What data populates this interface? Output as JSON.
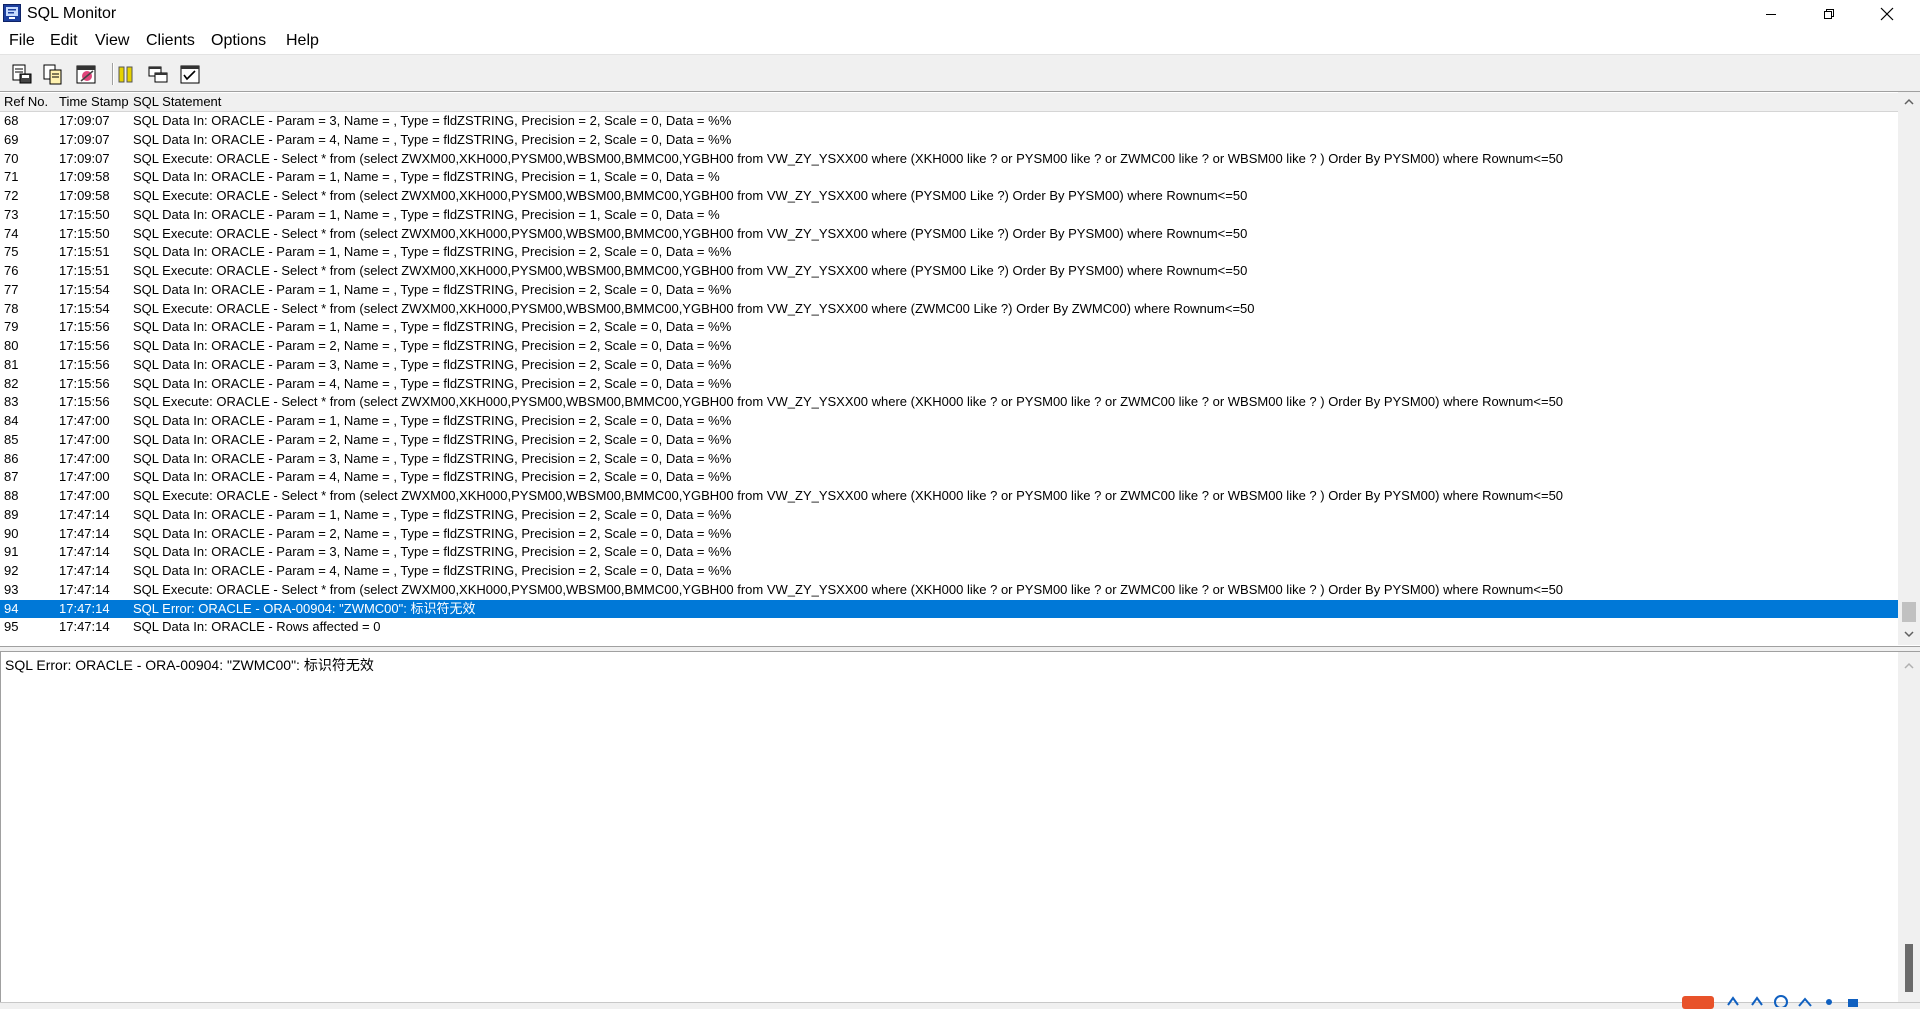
{
  "window": {
    "title": "SQL Monitor"
  },
  "menu": [
    "File",
    "Edit",
    "View",
    "Clients",
    "Options",
    "Help"
  ],
  "toolbar": {
    "icons": [
      "save-log-icon",
      "copy-icon",
      "clear-log-icon",
      "pause-icon",
      "window-tile-icon",
      "trace-options-icon"
    ]
  },
  "log": {
    "columns": {
      "ref": "Ref No.",
      "time": "Time Stamp",
      "sql": "SQL Statement"
    },
    "selected_ref": "94",
    "rows": [
      {
        "ref": "68",
        "time": "17:09:07",
        "sql": "SQL Data In: ORACLE - Param = 3, Name = , Type = fldZSTRING, Precision = 2, Scale = 0, Data = %%"
      },
      {
        "ref": "69",
        "time": "17:09:07",
        "sql": "SQL Data In: ORACLE - Param = 4, Name = , Type = fldZSTRING, Precision = 2, Scale = 0, Data = %%"
      },
      {
        "ref": "70",
        "time": "17:09:07",
        "sql": "SQL Execute: ORACLE - Select * from (select ZWXM00,XKH000,PYSM00,WBSM00,BMMC00,YGBH00 from VW_ZY_YSXX00 where (XKH000 like ? or PYSM00 like ? or ZWMC00 like ? or WBSM00 like ? ) Order By PYSM00) where Rownum<=50"
      },
      {
        "ref": "71",
        "time": "17:09:58",
        "sql": "SQL Data In: ORACLE - Param = 1, Name = , Type = fldZSTRING, Precision = 1, Scale = 0, Data = %"
      },
      {
        "ref": "72",
        "time": "17:09:58",
        "sql": "SQL Execute: ORACLE - Select * from (select ZWXM00,XKH000,PYSM00,WBSM00,BMMC00,YGBH00 from VW_ZY_YSXX00 where (PYSM00 Like ?) Order By PYSM00) where Rownum<=50"
      },
      {
        "ref": "73",
        "time": "17:15:50",
        "sql": "SQL Data In: ORACLE - Param = 1, Name = , Type = fldZSTRING, Precision = 1, Scale = 0, Data = %"
      },
      {
        "ref": "74",
        "time": "17:15:50",
        "sql": "SQL Execute: ORACLE - Select * from (select ZWXM00,XKH000,PYSM00,WBSM00,BMMC00,YGBH00 from VW_ZY_YSXX00 where (PYSM00 Like ?) Order By PYSM00) where Rownum<=50"
      },
      {
        "ref": "75",
        "time": "17:15:51",
        "sql": "SQL Data In: ORACLE - Param = 1, Name = , Type = fldZSTRING, Precision = 2, Scale = 0, Data = %%"
      },
      {
        "ref": "76",
        "time": "17:15:51",
        "sql": "SQL Execute: ORACLE - Select * from (select ZWXM00,XKH000,PYSM00,WBSM00,BMMC00,YGBH00 from VW_ZY_YSXX00 where (PYSM00 Like ?) Order By PYSM00) where Rownum<=50"
      },
      {
        "ref": "77",
        "time": "17:15:54",
        "sql": "SQL Data In: ORACLE - Param = 1, Name = , Type = fldZSTRING, Precision = 2, Scale = 0, Data = %%"
      },
      {
        "ref": "78",
        "time": "17:15:54",
        "sql": "SQL Execute: ORACLE - Select * from (select ZWXM00,XKH000,PYSM00,WBSM00,BMMC00,YGBH00 from VW_ZY_YSXX00 where (ZWMC00 Like ?) Order By ZWMC00) where Rownum<=50"
      },
      {
        "ref": "79",
        "time": "17:15:56",
        "sql": "SQL Data In: ORACLE - Param = 1, Name = , Type = fldZSTRING, Precision = 2, Scale = 0, Data = %%"
      },
      {
        "ref": "80",
        "time": "17:15:56",
        "sql": "SQL Data In: ORACLE - Param = 2, Name = , Type = fldZSTRING, Precision = 2, Scale = 0, Data = %%"
      },
      {
        "ref": "81",
        "time": "17:15:56",
        "sql": "SQL Data In: ORACLE - Param = 3, Name = , Type = fldZSTRING, Precision = 2, Scale = 0, Data = %%"
      },
      {
        "ref": "82",
        "time": "17:15:56",
        "sql": "SQL Data In: ORACLE - Param = 4, Name = , Type = fldZSTRING, Precision = 2, Scale = 0, Data = %%"
      },
      {
        "ref": "83",
        "time": "17:15:56",
        "sql": "SQL Execute: ORACLE - Select * from (select ZWXM00,XKH000,PYSM00,WBSM00,BMMC00,YGBH00 from VW_ZY_YSXX00 where (XKH000 like ? or PYSM00 like ? or ZWMC00 like ? or WBSM00 like ? ) Order By PYSM00) where Rownum<=50"
      },
      {
        "ref": "84",
        "time": "17:47:00",
        "sql": "SQL Data In: ORACLE - Param = 1, Name = , Type = fldZSTRING, Precision = 2, Scale = 0, Data = %%"
      },
      {
        "ref": "85",
        "time": "17:47:00",
        "sql": "SQL Data In: ORACLE - Param = 2, Name = , Type = fldZSTRING, Precision = 2, Scale = 0, Data = %%"
      },
      {
        "ref": "86",
        "time": "17:47:00",
        "sql": "SQL Data In: ORACLE - Param = 3, Name = , Type = fldZSTRING, Precision = 2, Scale = 0, Data = %%"
      },
      {
        "ref": "87",
        "time": "17:47:00",
        "sql": "SQL Data In: ORACLE - Param = 4, Name = , Type = fldZSTRING, Precision = 2, Scale = 0, Data = %%"
      },
      {
        "ref": "88",
        "time": "17:47:00",
        "sql": "SQL Execute: ORACLE - Select * from (select ZWXM00,XKH000,PYSM00,WBSM00,BMMC00,YGBH00 from VW_ZY_YSXX00 where (XKH000 like ? or PYSM00 like ? or ZWMC00 like ? or WBSM00 like ? ) Order By PYSM00) where Rownum<=50"
      },
      {
        "ref": "89",
        "time": "17:47:14",
        "sql": "SQL Data In: ORACLE - Param = 1, Name = , Type = fldZSTRING, Precision = 2, Scale = 0, Data = %%"
      },
      {
        "ref": "90",
        "time": "17:47:14",
        "sql": "SQL Data In: ORACLE - Param = 2, Name = , Type = fldZSTRING, Precision = 2, Scale = 0, Data = %%"
      },
      {
        "ref": "91",
        "time": "17:47:14",
        "sql": "SQL Data In: ORACLE - Param = 3, Name = , Type = fldZSTRING, Precision = 2, Scale = 0, Data = %%"
      },
      {
        "ref": "92",
        "time": "17:47:14",
        "sql": "SQL Data In: ORACLE - Param = 4, Name = , Type = fldZSTRING, Precision = 2, Scale = 0, Data = %%"
      },
      {
        "ref": "93",
        "time": "17:47:14",
        "sql": "SQL Execute: ORACLE - Select * from (select ZWXM00,XKH000,PYSM00,WBSM00,BMMC00,YGBH00 from VW_ZY_YSXX00 where (XKH000 like ? or PYSM00 like ? or ZWMC00 like ? or WBSM00 like ? ) Order By PYSM00) where Rownum<=50"
      },
      {
        "ref": "94",
        "time": "17:47:14",
        "sql": "SQL Error: ORACLE - ORA-00904: \"ZWMC00\": 标识符无效"
      },
      {
        "ref": "95",
        "time": "17:47:14",
        "sql": "SQL Data In: ORACLE - Rows affected = 0"
      }
    ]
  },
  "detail": {
    "text": "SQL Error: ORACLE - ORA-00904: \"ZWMC00\": 标识符无效"
  },
  "colors": {
    "selection": "#0078d7",
    "window_bg": "#f0f0f0",
    "list_bg": "#ffffff"
  }
}
